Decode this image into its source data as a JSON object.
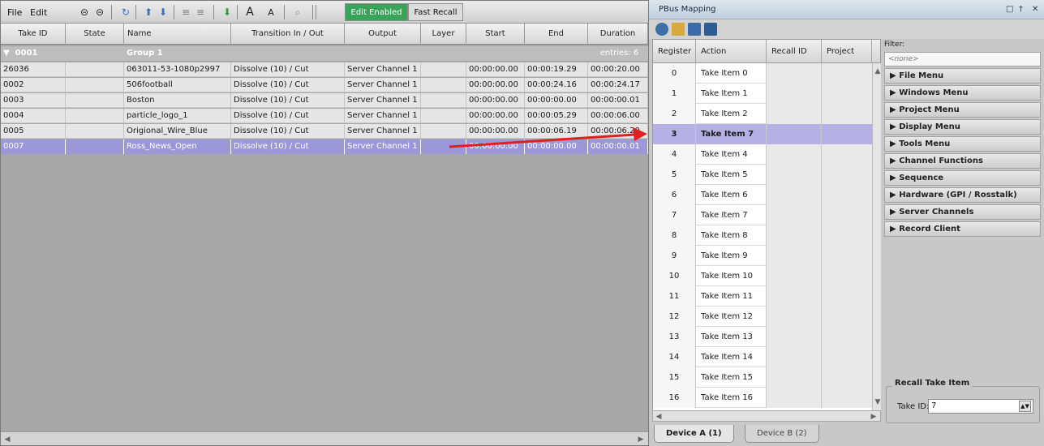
{
  "menu": {
    "file": "File",
    "edit": "Edit"
  },
  "toolbar": {
    "edit_enabled": "Edit Enabled",
    "fast_recall": "Fast Recall",
    "font_grow_label": "A",
    "font_shrink_label": "A"
  },
  "grid": {
    "columns": [
      "Take ID",
      "State",
      "Name",
      "Transition In / Out",
      "Output",
      "Layer",
      "Start",
      "End",
      "Duration"
    ],
    "group": {
      "id": "0001",
      "name": "Group 1",
      "entries": "entries: 6"
    },
    "rows": [
      {
        "take_id": "26036",
        "state": "",
        "name": "063011-53-1080p2997",
        "transition": "Dissolve (10) / Cut",
        "output": "Server Channel 1",
        "layer": "",
        "start": "00:00:00.00",
        "end": "00:00:19.29",
        "duration": "00:00:20.00"
      },
      {
        "take_id": "0002",
        "state": "",
        "name": "506football",
        "transition": "Dissolve (10) / Cut",
        "output": "Server Channel 1",
        "layer": "",
        "start": "00:00:00.00",
        "end": "00:00:24.16",
        "duration": "00:00:24.17"
      },
      {
        "take_id": "0003",
        "state": "",
        "name": "Boston",
        "transition": "Dissolve (10) / Cut",
        "output": "Server Channel 1",
        "layer": "",
        "start": "00:00:00.00",
        "end": "00:00:00.00",
        "duration": "00:00:00.01"
      },
      {
        "take_id": "0004",
        "state": "",
        "name": "particle_logo_1",
        "transition": "Dissolve (10) / Cut",
        "output": "Server Channel 1",
        "layer": "",
        "start": "00:00:00.00",
        "end": "00:00:05.29",
        "duration": "00:00:06.00"
      },
      {
        "take_id": "0005",
        "state": "",
        "name": "Origional_Wire_Blue",
        "transition": "Dissolve (10) / Cut",
        "output": "Server Channel 1",
        "layer": "",
        "start": "00:00:00.00",
        "end": "00:00:06.19",
        "duration": "00:00:06.20"
      },
      {
        "take_id": "0007",
        "state": "",
        "name": "Ross_News_Open",
        "transition": "Dissolve (10) / Cut",
        "output": "Server Channel 1",
        "layer": "",
        "start": "00:00:00.00",
        "end": "00:00:00.00",
        "duration": "00:00:00.01"
      }
    ]
  },
  "pbus": {
    "title": "PBus Mapping",
    "columns": [
      "Register",
      "Action",
      "Recall ID",
      "Project"
    ],
    "rows": [
      {
        "register": "0",
        "action": "Take Item 0"
      },
      {
        "register": "1",
        "action": "Take Item 1"
      },
      {
        "register": "2",
        "action": "Take Item 2"
      },
      {
        "register": "3",
        "action": "Take Item 7"
      },
      {
        "register": "4",
        "action": "Take Item 4"
      },
      {
        "register": "5",
        "action": "Take Item 5"
      },
      {
        "register": "6",
        "action": "Take Item 6"
      },
      {
        "register": "7",
        "action": "Take Item 7"
      },
      {
        "register": "8",
        "action": "Take Item 8"
      },
      {
        "register": "9",
        "action": "Take Item 9"
      },
      {
        "register": "10",
        "action": "Take Item 10"
      },
      {
        "register": "11",
        "action": "Take Item 11"
      },
      {
        "register": "12",
        "action": "Take Item 12"
      },
      {
        "register": "13",
        "action": "Take Item 13"
      },
      {
        "register": "14",
        "action": "Take Item 14"
      },
      {
        "register": "15",
        "action": "Take Item 15"
      },
      {
        "register": "16",
        "action": "Take Item 16"
      }
    ],
    "filter_label": "Filter:",
    "filter_placeholder": "<none>",
    "categories": [
      "File Menu",
      "Windows Menu",
      "Project Menu",
      "Display Menu",
      "Tools Menu",
      "Channel Functions",
      "Sequence",
      "Hardware (GPI / Rosstalk)",
      "Server Channels",
      "Record Client"
    ],
    "recall_title": "Recall Take Item",
    "take_id_label": "Take ID:",
    "take_id_value": "7",
    "tabs": [
      "Device A (1)",
      "Device B (2)"
    ]
  },
  "colors": {
    "selection": "#9c98d7",
    "edit_enabled": "#3aa35a",
    "arrow": "#e02020"
  }
}
